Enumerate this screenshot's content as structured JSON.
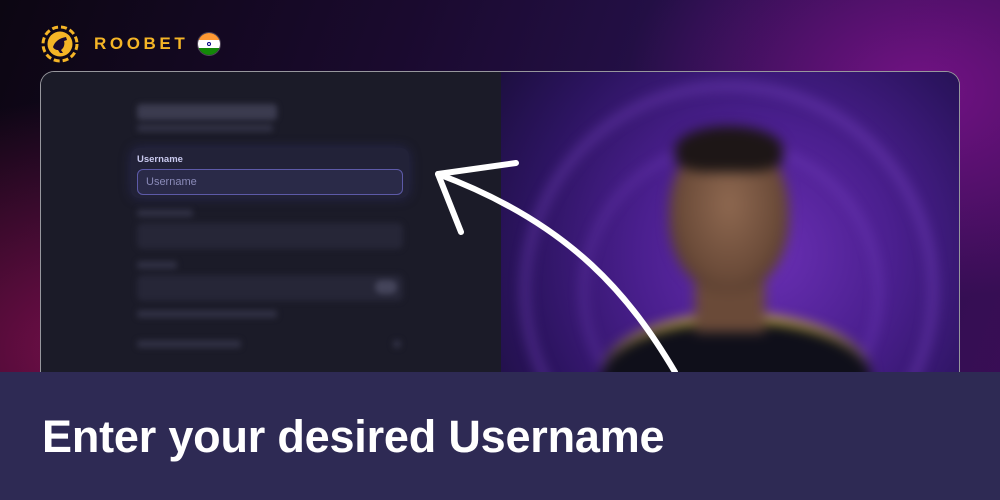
{
  "brand": {
    "name": "ROOBET",
    "logo_icon": "roobet-kangaroo-logo-icon",
    "flag_icon": "india-flag-icon",
    "accent_color": "#f5b526"
  },
  "signup_form": {
    "username_label": "Username",
    "username_placeholder": "Username",
    "username_value": ""
  },
  "caption": {
    "text": "Enter your desired Username",
    "background_color": "#2e2a54"
  },
  "annotation": {
    "arrow_icon": "pointer-arrow-icon",
    "arrow_color": "#ffffff"
  }
}
